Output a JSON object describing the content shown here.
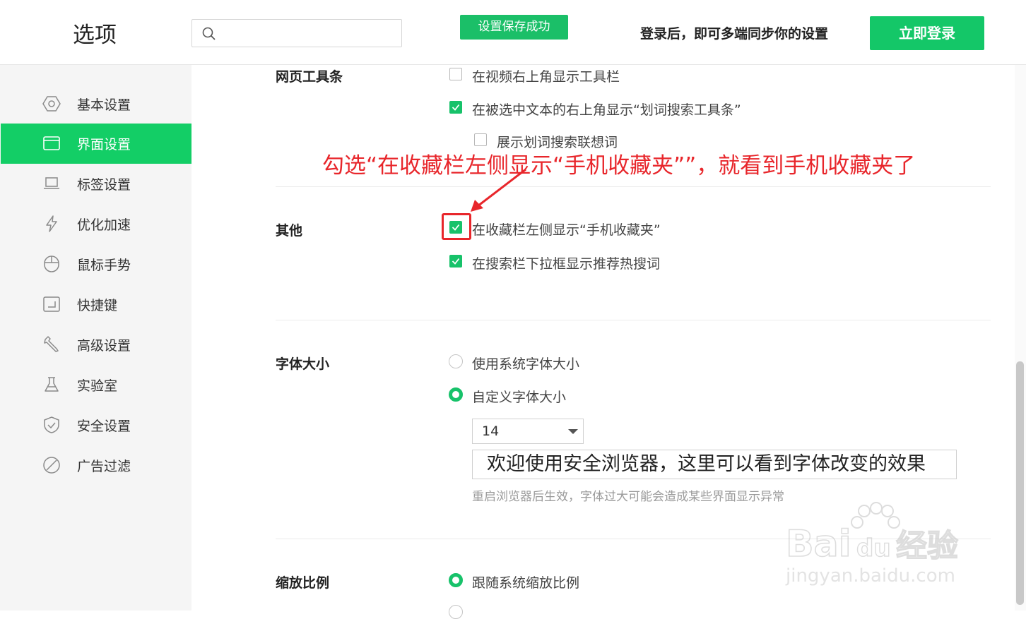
{
  "header": {
    "title": "选项",
    "search_placeholder": "",
    "toast": "设置保存成功",
    "login_tip": "登录后，即可多端同步你的设置",
    "login_button": "立即登录"
  },
  "sidebar": {
    "items": [
      {
        "label": "基本设置",
        "icon": "hexagon-gear-icon",
        "active": false
      },
      {
        "label": "界面设置",
        "icon": "window-icon",
        "active": true
      },
      {
        "label": "标签设置",
        "icon": "laptop-icon",
        "active": false
      },
      {
        "label": "优化加速",
        "icon": "lightning-icon",
        "active": false
      },
      {
        "label": "鼠标手势",
        "icon": "mouse-icon",
        "active": false
      },
      {
        "label": "快捷键",
        "icon": "keyboard-icon",
        "active": false
      },
      {
        "label": "高级设置",
        "icon": "wrench-icon",
        "active": false
      },
      {
        "label": "实验室",
        "icon": "flask-icon",
        "active": false
      },
      {
        "label": "安全设置",
        "icon": "shield-icon",
        "active": false
      },
      {
        "label": "广告过滤",
        "icon": "block-icon",
        "active": false
      }
    ]
  },
  "sections": {
    "toolbar": {
      "label": "网页工具条",
      "options": [
        {
          "label": "在视频右上角显示工具栏",
          "checked": false
        },
        {
          "label": "在被选中文本的右上角显示“划词搜索工具条”",
          "checked": true
        },
        {
          "label": "展示划词搜索联想词",
          "checked": false
        }
      ]
    },
    "other": {
      "label": "其他",
      "options": [
        {
          "label": "在收藏栏左侧显示“手机收藏夹”",
          "checked": true
        },
        {
          "label": "在搜索栏下拉框显示推荐热搜词",
          "checked": true
        }
      ]
    },
    "font": {
      "label": "字体大小",
      "options": [
        {
          "label": "使用系统字体大小",
          "selected": false
        },
        {
          "label": "自定义字体大小",
          "selected": true
        }
      ],
      "size_value": "14",
      "preview_text": "欢迎使用安全浏览器，这里可以看到字体改变的效果",
      "hint": "重启浏览器后生效，字体过大可能会造成某些界面显示异常"
    },
    "zoom": {
      "label": "缩放比例",
      "options": [
        {
          "label": "跟随系统缩放比例",
          "selected": true
        }
      ]
    }
  },
  "annotation": "勾选“在收藏栏左侧显示“手机收藏夹””，就看到手机收藏夹了",
  "watermark": {
    "brand": "Bai du 经验",
    "url": "jingyan.baidu.com"
  },
  "colors": {
    "accent": "#13ce66",
    "annotation": "#e8262b"
  }
}
